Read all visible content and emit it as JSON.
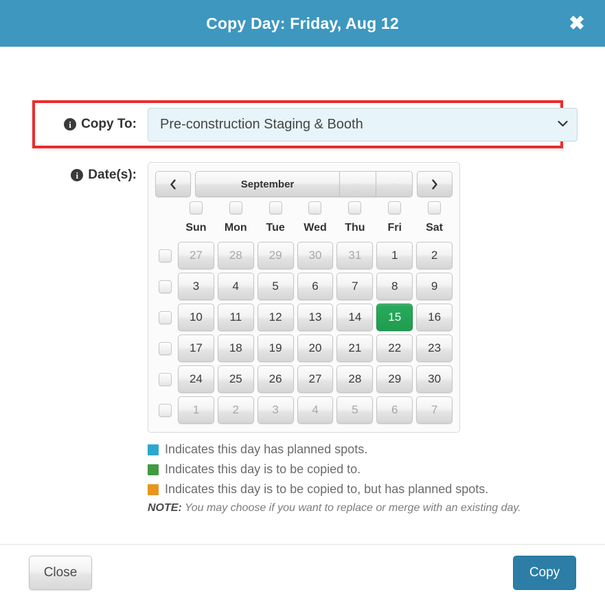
{
  "header": {
    "title": "Copy Day: Friday, Aug 12",
    "close_label": "✖",
    "bg_color": "#3d97bf"
  },
  "form": {
    "copy_to": {
      "label": "Copy To:",
      "value": "Pre-construction Staging & Booth",
      "caret": "⌄",
      "highlight_color": "#ee2b2b",
      "field_bg": "#e7f4f9"
    },
    "dates": {
      "label": "Date(s):"
    }
  },
  "calendar": {
    "prev_label": "‹",
    "next_label": "›",
    "month": "September",
    "seg_a": "·",
    "seg_b": "·",
    "dow": [
      "Sun",
      "Mon",
      "Tue",
      "Wed",
      "Thu",
      "Fri",
      "Sat"
    ],
    "weeks": [
      [
        {
          "d": "27",
          "other": true,
          "sel": false
        },
        {
          "d": "28",
          "other": true,
          "sel": false
        },
        {
          "d": "29",
          "other": true,
          "sel": false
        },
        {
          "d": "30",
          "other": true,
          "sel": false
        },
        {
          "d": "31",
          "other": true,
          "sel": false
        },
        {
          "d": "1",
          "other": false,
          "sel": false
        },
        {
          "d": "2",
          "other": false,
          "sel": false
        }
      ],
      [
        {
          "d": "3",
          "other": false,
          "sel": false
        },
        {
          "d": "4",
          "other": false,
          "sel": false
        },
        {
          "d": "5",
          "other": false,
          "sel": false
        },
        {
          "d": "6",
          "other": false,
          "sel": false
        },
        {
          "d": "7",
          "other": false,
          "sel": false
        },
        {
          "d": "8",
          "other": false,
          "sel": false
        },
        {
          "d": "9",
          "other": false,
          "sel": false
        }
      ],
      [
        {
          "d": "10",
          "other": false,
          "sel": false
        },
        {
          "d": "11",
          "other": false,
          "sel": false
        },
        {
          "d": "12",
          "other": false,
          "sel": false
        },
        {
          "d": "13",
          "other": false,
          "sel": false
        },
        {
          "d": "14",
          "other": false,
          "sel": false
        },
        {
          "d": "15",
          "other": false,
          "sel": true
        },
        {
          "d": "16",
          "other": false,
          "sel": false
        }
      ],
      [
        {
          "d": "17",
          "other": false,
          "sel": false
        },
        {
          "d": "18",
          "other": false,
          "sel": false
        },
        {
          "d": "19",
          "other": false,
          "sel": false
        },
        {
          "d": "20",
          "other": false,
          "sel": false
        },
        {
          "d": "21",
          "other": false,
          "sel": false
        },
        {
          "d": "22",
          "other": false,
          "sel": false
        },
        {
          "d": "23",
          "other": false,
          "sel": false
        }
      ],
      [
        {
          "d": "24",
          "other": false,
          "sel": false
        },
        {
          "d": "25",
          "other": false,
          "sel": false
        },
        {
          "d": "26",
          "other": false,
          "sel": false
        },
        {
          "d": "27",
          "other": false,
          "sel": false
        },
        {
          "d": "28",
          "other": false,
          "sel": false
        },
        {
          "d": "29",
          "other": false,
          "sel": false
        },
        {
          "d": "30",
          "other": false,
          "sel": false
        }
      ],
      [
        {
          "d": "1",
          "other": true,
          "sel": false
        },
        {
          "d": "2",
          "other": true,
          "sel": false
        },
        {
          "d": "3",
          "other": true,
          "sel": false
        },
        {
          "d": "4",
          "other": true,
          "sel": false
        },
        {
          "d": "5",
          "other": true,
          "sel": false
        },
        {
          "d": "6",
          "other": true,
          "sel": false
        },
        {
          "d": "7",
          "other": true,
          "sel": false
        }
      ]
    ],
    "selected_color": "#1f9d4f"
  },
  "legend": {
    "items": [
      {
        "color": "#2aa8d0",
        "text": "Indicates this day has planned spots."
      },
      {
        "color": "#3f9a41",
        "text": "Indicates this day is to be copied to."
      },
      {
        "color": "#e8951e",
        "text": "Indicates this day is to be copied to, but has planned spots."
      }
    ],
    "note_prefix": "NOTE:",
    "note_text": " You may choose if you want to replace or merge with an existing day."
  },
  "footer": {
    "close_label": "Close",
    "copy_label": "Copy",
    "copy_color": "#2c7ea7"
  }
}
